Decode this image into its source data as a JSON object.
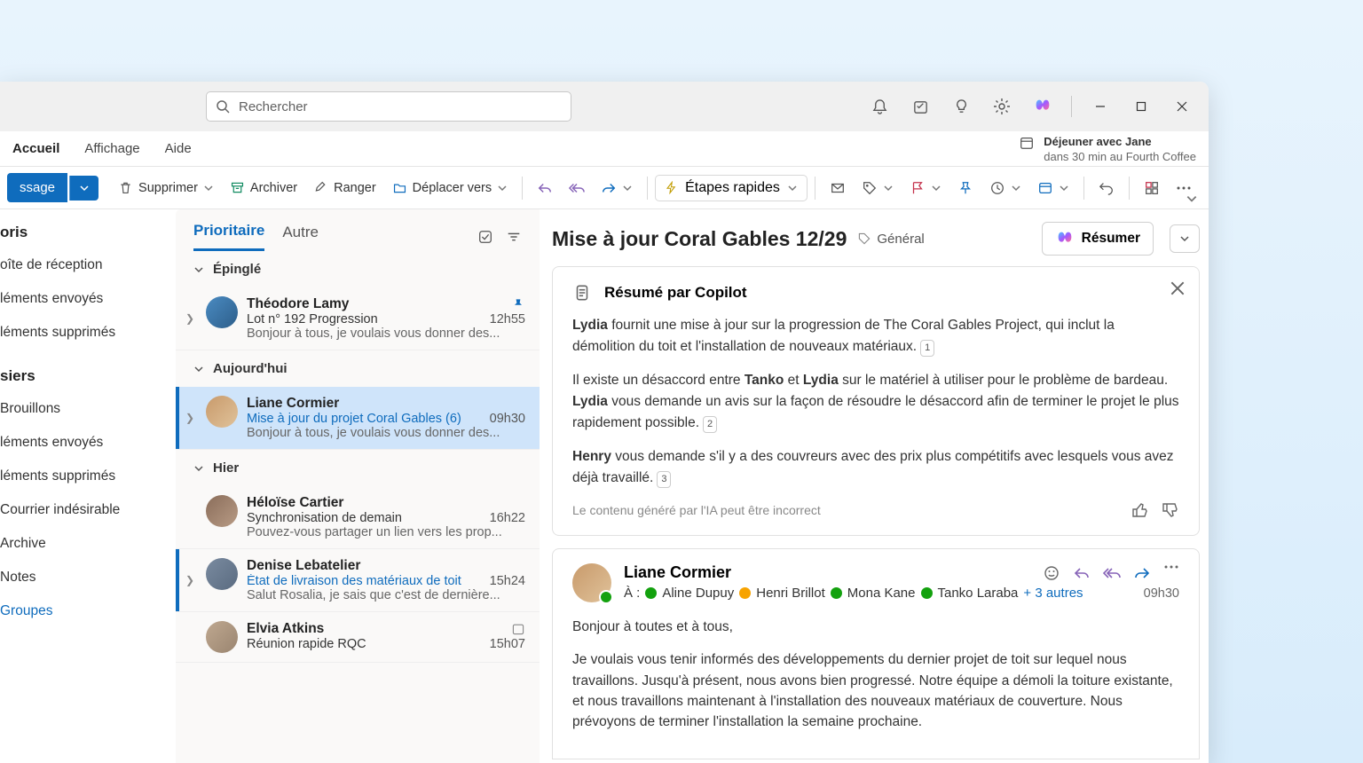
{
  "search": {
    "placeholder": "Rechercher"
  },
  "menubar": {
    "home": "Accueil",
    "view": "Affichage",
    "help": "Aide"
  },
  "reminder": {
    "title": "Déjeuner avec Jane",
    "sub": "dans 30 min au Fourth Coffee"
  },
  "toolbar": {
    "new_message": "ssage",
    "delete": "Supprimer",
    "archive": "Archiver",
    "sweep": "Ranger",
    "move_to": "Déplacer vers",
    "quick_steps": "Étapes rapides"
  },
  "folders": {
    "favorites_header": "oris",
    "inbox": "oîte de réception",
    "sent1": "léments envoyés",
    "deleted1": "léments supprimés",
    "folders_header": "siers",
    "drafts": "Brouillons",
    "sent2": "léments envoyés",
    "deleted2": "léments supprimés",
    "junk": "Courrier indésirable",
    "archive": "Archive",
    "notes": "Notes",
    "groups": "Groupes"
  },
  "list": {
    "tab_focused": "Prioritaire",
    "tab_other": "Autre",
    "sec_pinned": "Épinglé",
    "sec_today": "Aujourd'hui",
    "sec_yesterday": "Hier",
    "items": [
      {
        "from": "Théodore Lamy",
        "subject": "Lot n° 192 Progression",
        "time": "12h55",
        "preview": "Bonjour à tous, je voulais vous donner des..."
      },
      {
        "from": "Liane Cormier",
        "subject": "Mise à jour du projet Coral Gables (6)",
        "time": "09h30",
        "preview": "Bonjour à tous, je voulais vous donner des..."
      },
      {
        "from": "Héloïse Cartier",
        "subject": "Synchronisation de demain",
        "time": "16h22",
        "preview": "Pouvez-vous partager un lien vers les prop..."
      },
      {
        "from": "Denise Lebatelier",
        "subject": "État de livraison des matériaux de toit",
        "time": "15h24",
        "preview": "Salut Rosalia, je sais que c'est de dernière..."
      },
      {
        "from": "Elvia Atkins",
        "subject": "Réunion rapide RQC",
        "time": "15h07",
        "preview": ""
      }
    ]
  },
  "reading": {
    "title": "Mise à jour Coral Gables 12/29",
    "category": "Général",
    "summarize": "Résumer",
    "copilot_header": "Résumé par Copilot",
    "p1a": "Lydia",
    "p1b": " fournit une mise à jour sur la progression de The Coral Gables Project, qui inclut la démolition du toit et l'installation de nouveaux matériaux.",
    "p2a": "Il existe un désaccord entre ",
    "p2b": "Tanko",
    "p2c": " et ",
    "p2d": "Lydia",
    "p2e": " sur le matériel à utiliser pour le problème de bardeau. ",
    "p2f": "Lydia",
    "p2g": " vous demande un avis sur la façon de résoudre le désaccord afin de terminer le projet le plus rapidement possible.",
    "p3a": "Henry",
    "p3b": " vous demande s'il y a des couvreurs avec des prix plus compétitifs avec lesquels vous avez déjà travaillé.",
    "disclaimer": "Le contenu généré par l'IA peut être incorrect",
    "ref1": "1",
    "ref2": "2",
    "ref3": "3"
  },
  "mail": {
    "from": "Liane Cormier",
    "to_label": "À :",
    "r1": "Aline Dupuy",
    "r2": "Henri Brillot",
    "r3": "Mona Kane",
    "r4": "Tanko Laraba",
    "more": "+ 3 autres",
    "time": "09h30",
    "greeting": "Bonjour à toutes et à tous,",
    "body": "Je voulais vous tenir informés des développements du dernier projet de toit sur lequel nous travaillons. Jusqu'à présent, nous avons bien progressé. Notre équipe a démoli la toiture existante, et nous travaillons maintenant à l'installation des nouveaux matériaux de couverture. Nous prévoyons de terminer l'installation la semaine prochaine."
  }
}
